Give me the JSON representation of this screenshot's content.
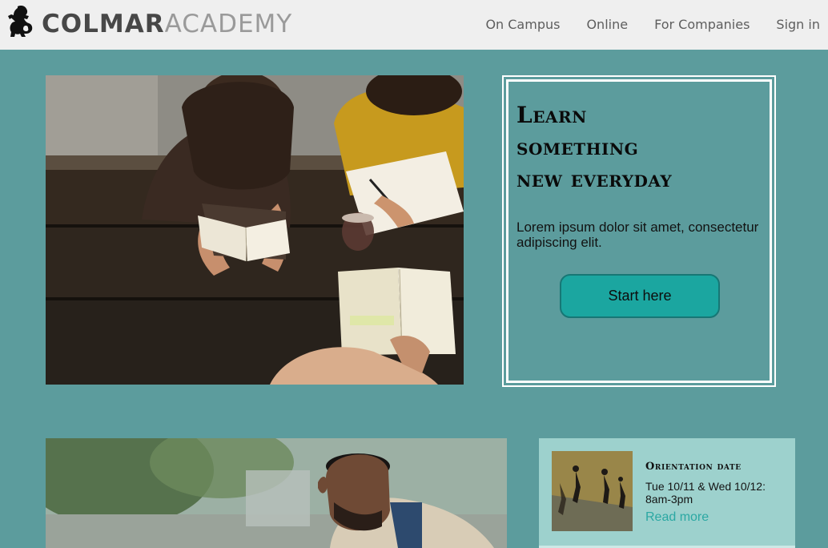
{
  "brand": {
    "name_strong": "COLMAR",
    "name_light": "ACADEMY"
  },
  "nav": {
    "items": [
      "On Campus",
      "Online",
      "For Companies",
      "Sign in"
    ]
  },
  "hero": {
    "title_lines": [
      "Learn",
      "something",
      "new everyday"
    ],
    "text": "Lorem ipsum dolor sit amet, consectetur adipiscing elit.",
    "button_label": "Start here"
  },
  "event": {
    "title": "Orientation date",
    "date": "Tue 10/11 & Wed 10/12: 8am-3pm",
    "link_label": "Read more"
  },
  "colors": {
    "page_bg": "#5c9c9d",
    "header_bg": "#efefef",
    "button_bg": "#1ba6a0",
    "card_bg": "#9dd1cd",
    "link": "#2ba8a3"
  },
  "icons": {
    "logo": "lion-crest-icon"
  }
}
